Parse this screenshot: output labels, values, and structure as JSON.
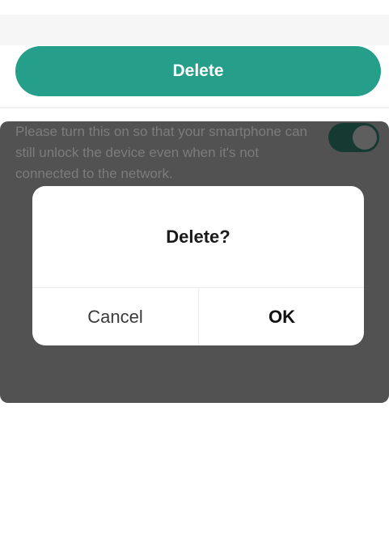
{
  "top": {
    "delete_label": "Delete"
  },
  "background": {
    "description_text": "Please turn this on so that your smartphone can still unlock the device even when it's not connected to the network.",
    "toggle_state": "on"
  },
  "dialog": {
    "title": "Delete?",
    "cancel_label": "Cancel",
    "ok_label": "OK"
  },
  "colors": {
    "accent": "#259f89",
    "overlay": "#525252",
    "toggle_dim": "#163a32"
  }
}
